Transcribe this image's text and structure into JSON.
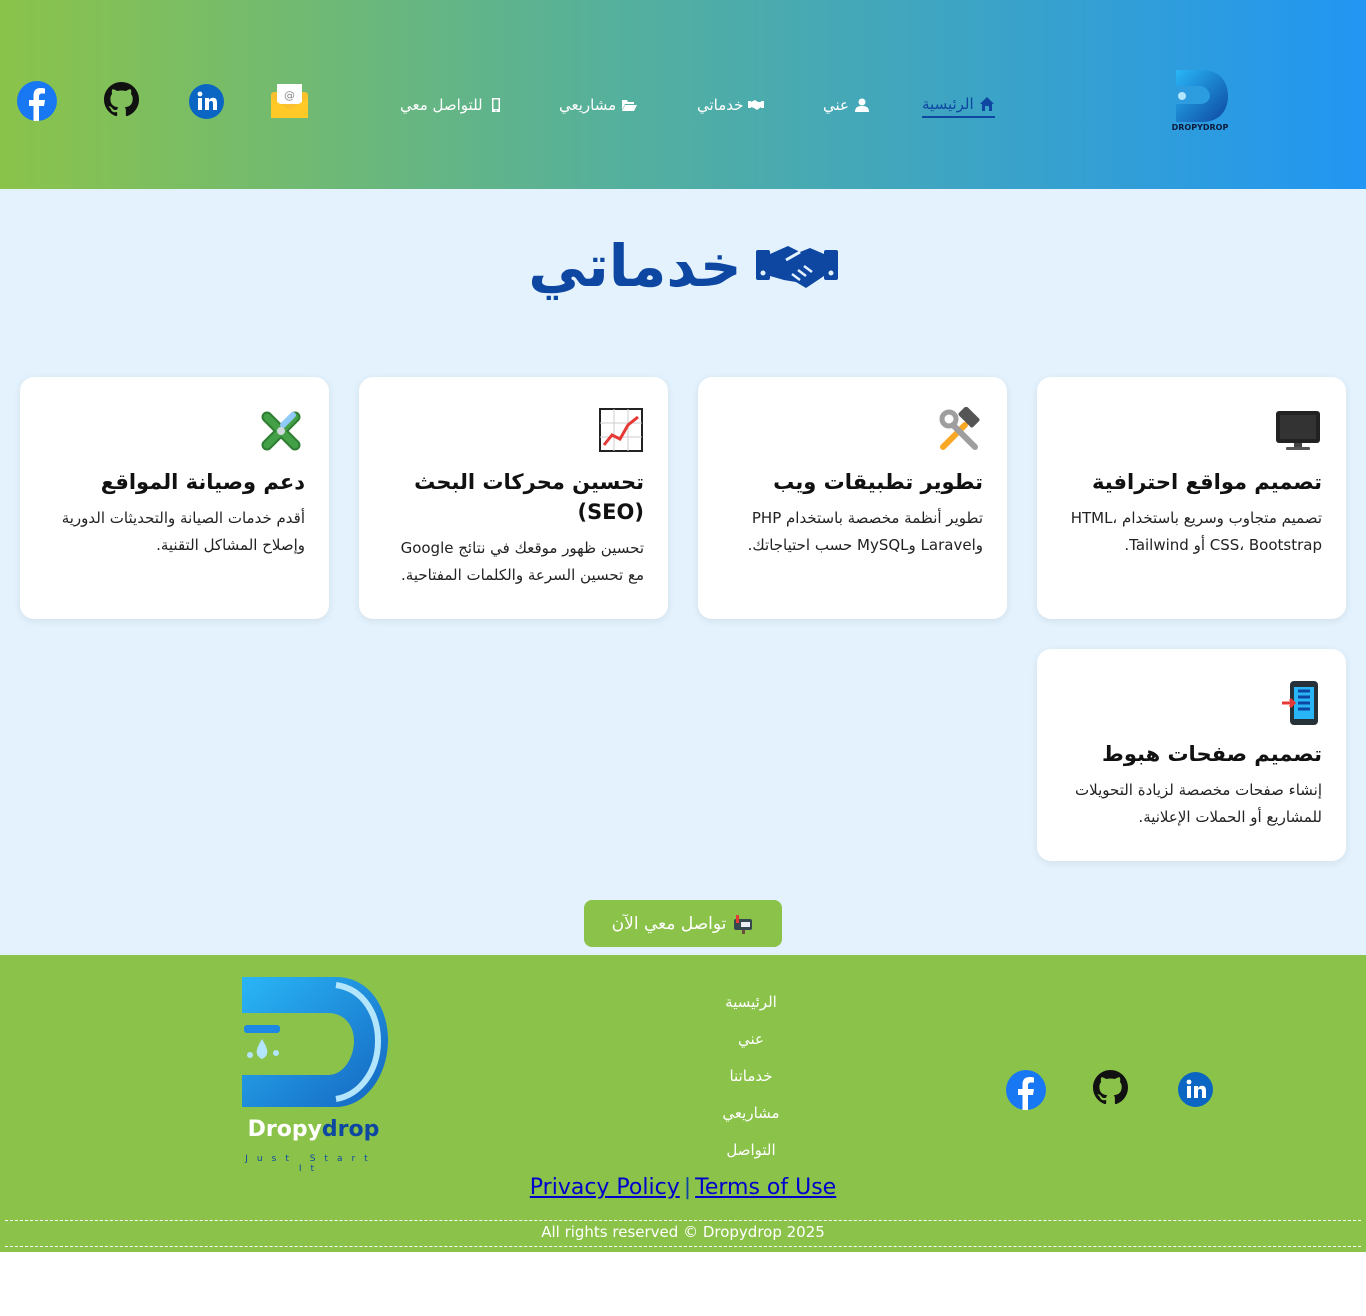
{
  "header": {
    "nav": [
      {
        "label": "الرئيسية",
        "icon": "home-icon",
        "active": true
      },
      {
        "label": "عني",
        "icon": "user-icon",
        "active": false
      },
      {
        "label": "خدماتي",
        "icon": "handshake-icon",
        "active": false
      },
      {
        "label": "مشاريعي",
        "icon": "folder-open-icon",
        "active": false
      },
      {
        "label": "للتواصل معي",
        "icon": "mobile-icon",
        "active": false
      }
    ],
    "social": [
      "email-icon",
      "linkedin-icon",
      "github-icon",
      "facebook-icon"
    ]
  },
  "services": {
    "title": "خدماتي",
    "title_icon": "handshake-icon",
    "cards": [
      {
        "title": "تصميم مواقع احترافية",
        "desc": "تصميم متجاوب وسريع باستخدام HTML، CSS، Bootstrap أو Tailwind.",
        "icon": "desktop-computer-icon"
      },
      {
        "title": "تطوير تطبيقات ويب",
        "desc": "تطوير أنظمة مخصصة باستخدام PHP وLaravel وMySQL حسب احتياجاتك.",
        "icon": "hammer-wrench-icon"
      },
      {
        "title": "تحسين محركات البحث (SEO)",
        "desc": "تحسين ظهور موقعك في نتائج Google مع تحسين السرعة والكلمات المفتاحية.",
        "icon": "chart-increasing-icon"
      },
      {
        "title": "دعم وصيانة المواقع",
        "desc": "أقدم خدمات الصيانة والتحديثات الدورية وإصلاح المشاكل التقنية.",
        "icon": "tools-cross-icon"
      },
      {
        "title": "تصميم صفحات هبوط",
        "desc": "إنشاء صفحات مخصصة لزيادة التحويلات للمشاريع أو الحملات الإعلانية.",
        "icon": "mobile-arrow-icon"
      }
    ],
    "cta_label": "تواصل معي الآن",
    "cta_icon": "mailbox-icon"
  },
  "footer": {
    "links": [
      "الرئيسية",
      "عني",
      "خدماتنا",
      "مشاريعي",
      "التواصل"
    ],
    "brand_part1": "Dropy",
    "brand_part2": "drop",
    "tagline": "Just Start It",
    "logo_text": "DROPYDROP",
    "privacy": "Privacy Policy",
    "separator": "|",
    "terms": "Terms of Use",
    "copyright": "All rights reserved © Dropydrop 2025",
    "social": [
      "linkedin-icon",
      "github-icon",
      "facebook-icon"
    ]
  },
  "colors": {
    "primary": "#0d47a1",
    "green": "#8bc34a",
    "blue": "#2196f3",
    "page_bg": "#e3f2fd"
  }
}
